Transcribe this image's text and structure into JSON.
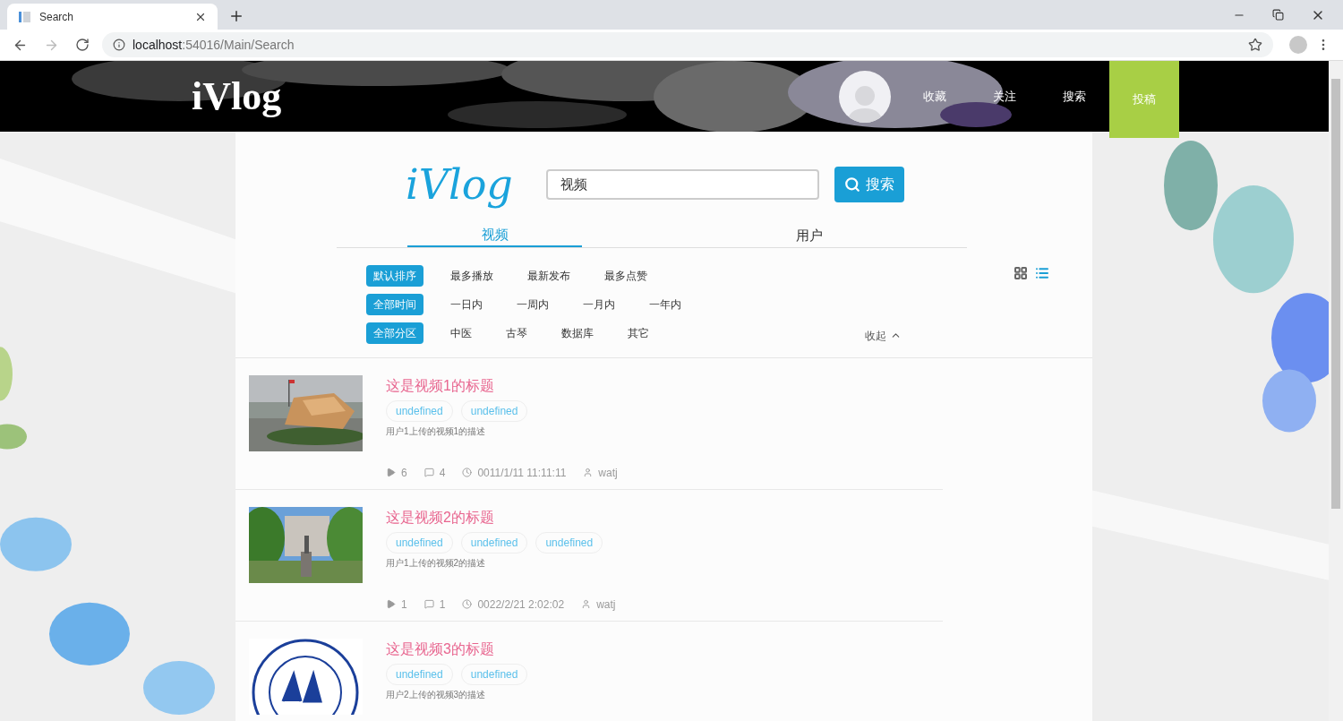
{
  "browser": {
    "tab_title": "Search",
    "url_host": "localhost",
    "url_rest": ":54016/Main/Search"
  },
  "header": {
    "logo": "iVlog",
    "nav": [
      {
        "label": "收藏",
        "selected": false
      },
      {
        "label": "关注",
        "selected": false
      },
      {
        "label": "搜索",
        "selected": false
      },
      {
        "label": "投稿",
        "selected": true
      }
    ]
  },
  "search": {
    "logo": "iVlog",
    "value": "视频",
    "button": "搜索"
  },
  "tabs": [
    {
      "label": "视频",
      "selected": true
    },
    {
      "label": "用户",
      "selected": false
    }
  ],
  "filters": [
    {
      "options": [
        {
          "label": "默认排序",
          "selected": true
        },
        {
          "label": "最多播放",
          "selected": false
        },
        {
          "label": "最新发布",
          "selected": false
        },
        {
          "label": "最多点赞",
          "selected": false
        }
      ]
    },
    {
      "options": [
        {
          "label": "全部时间",
          "selected": true
        },
        {
          "label": "一日内",
          "selected": false
        },
        {
          "label": "一周内",
          "selected": false
        },
        {
          "label": "一月内",
          "selected": false
        },
        {
          "label": "一年内",
          "selected": false
        }
      ]
    },
    {
      "options": [
        {
          "label": "全部分区",
          "selected": true
        },
        {
          "label": "中医",
          "selected": false
        },
        {
          "label": "古琴",
          "selected": false
        },
        {
          "label": "数据库",
          "selected": false
        },
        {
          "label": "其它",
          "selected": false
        }
      ]
    }
  ],
  "view_modes": [
    {
      "kind": "grid",
      "selected": false
    },
    {
      "kind": "list",
      "selected": true
    }
  ],
  "collapse": "收起",
  "videos": [
    {
      "title": "这是视频1的标题",
      "tags": [
        "undefined",
        "undefined"
      ],
      "description": "用户1上传的视频1的描述",
      "plays": "6",
      "comments": "4",
      "date": "0011/1/11 11:11:11",
      "author": "watj"
    },
    {
      "title": "这是视频2的标题",
      "tags": [
        "undefined",
        "undefined",
        "undefined"
      ],
      "description": "用户1上传的视频2的描述",
      "plays": "1",
      "comments": "1",
      "date": "0022/2/21 2:02:02",
      "author": "watj"
    },
    {
      "title": "这是视频3的标题",
      "tags": [
        "undefined",
        "undefined"
      ],
      "description": "用户2上传的视频3的描述"
    }
  ]
}
